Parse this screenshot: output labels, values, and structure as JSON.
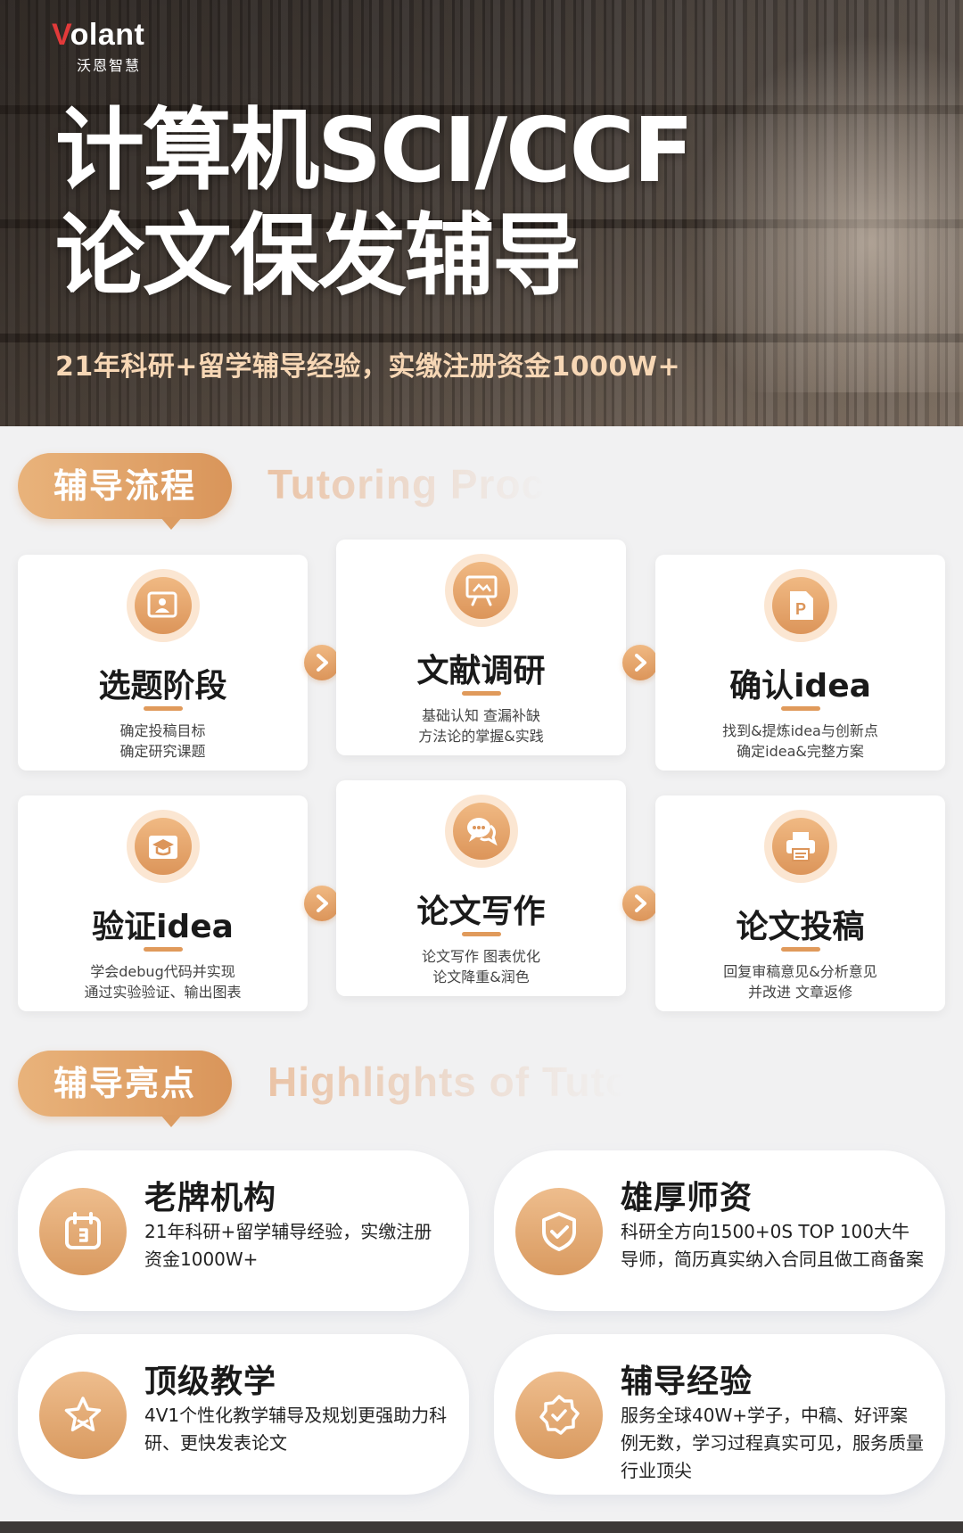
{
  "brand": {
    "logo_prefix": "V",
    "logo_rest": "olant",
    "logo_sub": "沃恩智慧"
  },
  "hero": {
    "title_line1": "计算机SCI/CCF",
    "title_line2": "论文保发辅导",
    "subtitle": "21年科研+留学辅导经验，实缴注册资金1000W+"
  },
  "process": {
    "heading": "辅导流程",
    "heading_en": "Tutoring Process",
    "steps": [
      {
        "title": "选题阶段",
        "line1": "确定投稿目标",
        "line2": "确定研究课题",
        "icon": "presentation-person-icon"
      },
      {
        "title": "文献调研",
        "line1": "基础认知 查漏补缺",
        "line2": "方法论的掌握&实践",
        "icon": "easel-icon"
      },
      {
        "title": "确认idea",
        "line1": "找到&提炼idea与创新点",
        "line2": "确定idea&完整方案",
        "icon": "powerpoint-icon"
      },
      {
        "title": "验证idea",
        "line1": "学会debug代码并实现",
        "line2": "通过实验验证、输出图表",
        "icon": "graduation-cap-icon"
      },
      {
        "title": "论文写作",
        "line1": "论文写作 图表优化",
        "line2": "论文降重&润色",
        "icon": "chat-bubbles-icon"
      },
      {
        "title": "论文投稿",
        "line1": "回复审稿意见&分析意见",
        "line2": "并改进 文章返修",
        "icon": "printer-icon"
      }
    ]
  },
  "highlights": {
    "heading": "辅导亮点",
    "heading_en": "Highlights of Tutoring",
    "items": [
      {
        "title": "老牌机构",
        "desc": "21年科研+留学辅导经验，实缴注册资金1000W+",
        "icon": "calendar-icon"
      },
      {
        "title": "雄厚师资",
        "desc": "科研全方向1500+0S TOP 100大牛导师，简历真实纳入合同且做工商备案",
        "icon": "shield-check-icon"
      },
      {
        "title": "顶级教学",
        "desc": "4V1个性化教学辅导及规划更强助力科研、更快发表论文",
        "icon": "star-icon"
      },
      {
        "title": "辅导经验",
        "desc": "服务全球40W+学子，中稿、好评案例无数，学习过程真实可见，服务质量行业顶尖",
        "icon": "badge-icon"
      }
    ]
  },
  "colors": {
    "accent": "#dc955a",
    "accent_light": "#f0b983",
    "hero_subtitle": "#f7d7b5",
    "page_bg": "#f1f1f2"
  }
}
